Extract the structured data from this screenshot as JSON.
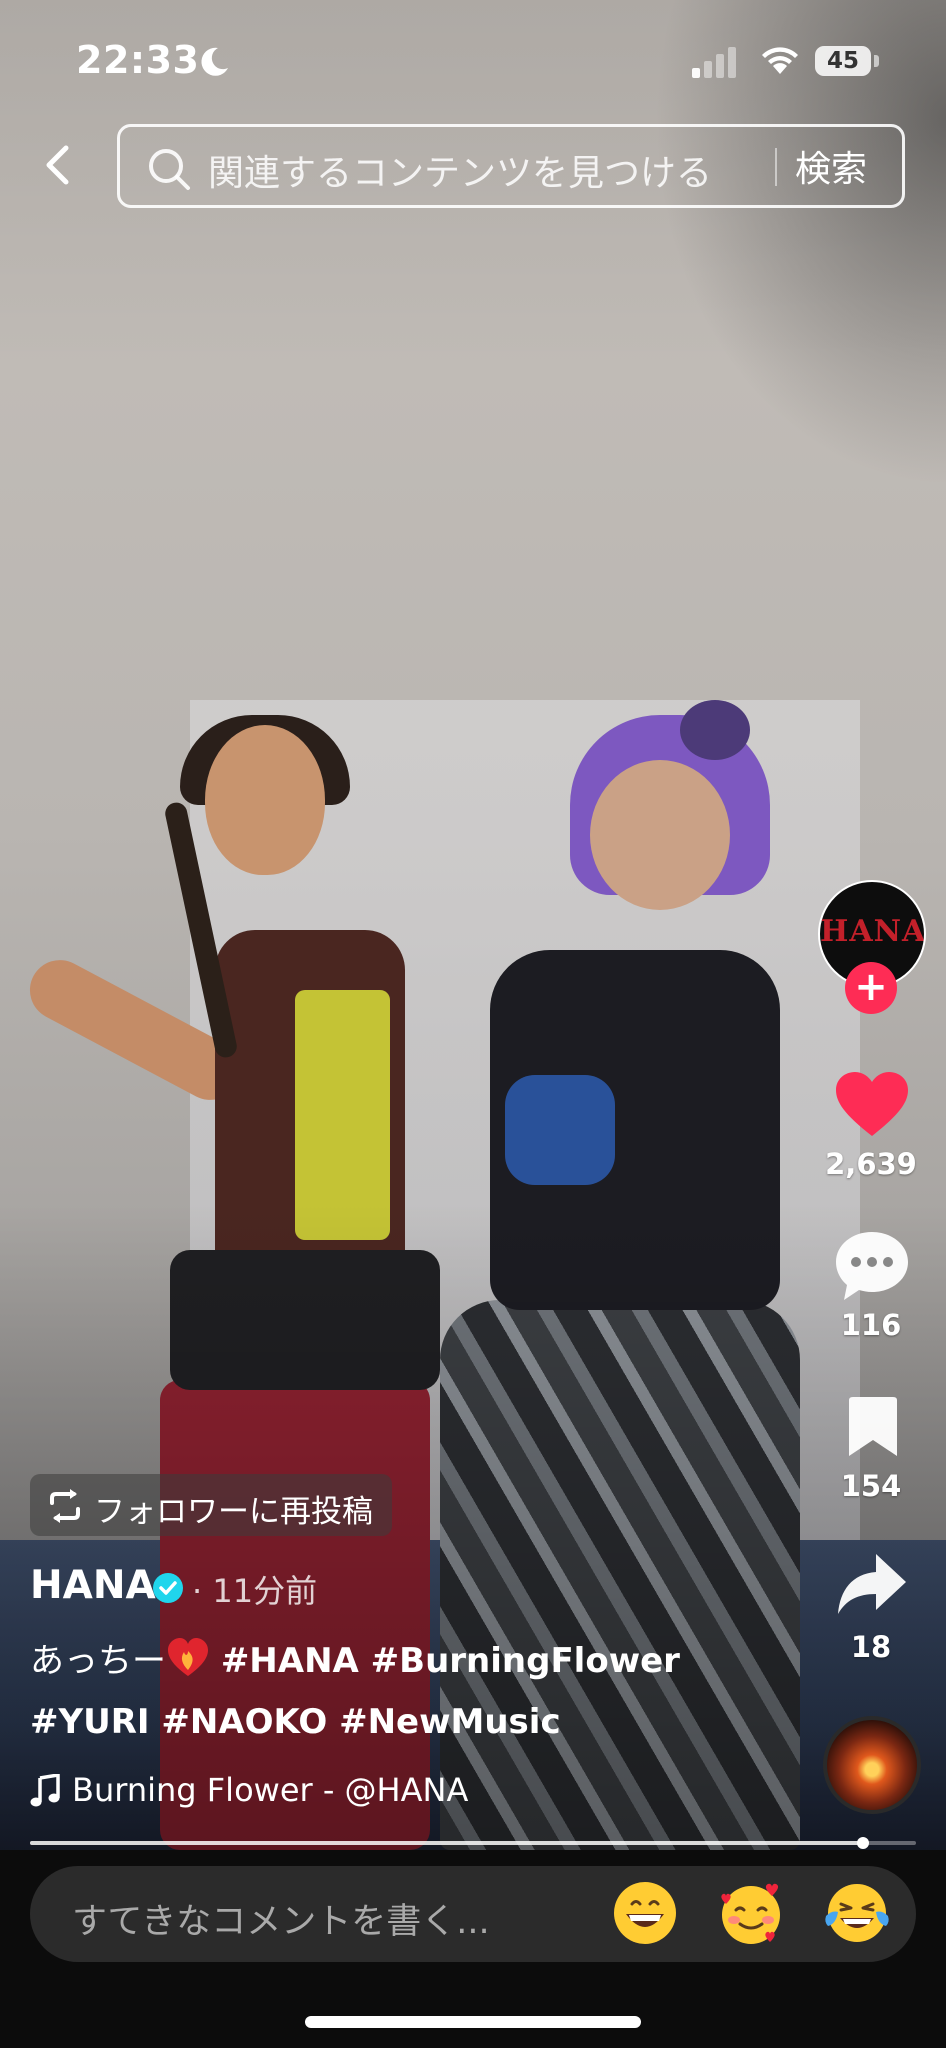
{
  "status_bar": {
    "time": "22:33",
    "battery": "45"
  },
  "search": {
    "placeholder": "関連するコンテンツを見つける",
    "button_label": "検索"
  },
  "actions": {
    "likes": "2,639",
    "comments": "116",
    "bookmarks": "154",
    "shares": "18"
  },
  "creator": {
    "avatar_text": "HANA",
    "follow_symbol": "+"
  },
  "post": {
    "repost_label": "フォロワーに再投稿",
    "username": "HANA",
    "time_ago": "· 11分前",
    "caption_prefix": "あっちー",
    "caption_tags_line1": "#HANA #BurningFlower",
    "caption_line2": "#YURI #NAOKO #NewMusic",
    "music": "Burning Flower - @HANA"
  },
  "playback": {
    "progress_fraction": 0.94
  },
  "comment": {
    "placeholder": "すてきなコメントを書く..."
  },
  "emojis": [
    "grinning-face",
    "smiling-face-with-hearts",
    "tears-of-joy"
  ],
  "colors": {
    "like": "#fe2c55",
    "follow": "#fe2c55",
    "verified": "#20d5ec"
  }
}
